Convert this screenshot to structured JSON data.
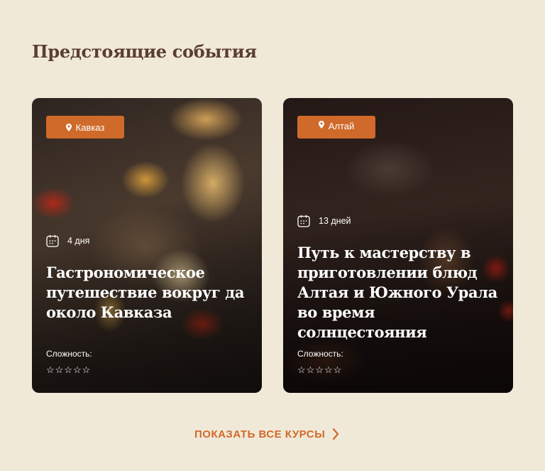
{
  "section": {
    "title": "Предстоящие события"
  },
  "events": [
    {
      "location": "Кавказ",
      "duration": "4 дня",
      "title": "Гастрономическое путешествие вокруг да около Кавказа",
      "difficulty_label": "Сложность:",
      "rating": 0,
      "rating_max": 5,
      "rating_display": "☆☆☆☆☆"
    },
    {
      "location": "Алтай",
      "duration": "13 дней",
      "title": "Путь к мастерству в приготовлении блюд Алтая и Южного Урала во время солнцестояния",
      "difficulty_label": "Сложность:",
      "rating": 0,
      "rating_max": 5,
      "rating_display": "☆☆☆☆☆"
    }
  ],
  "show_all": {
    "label": "ПОКАЗАТЬ ВСЕ КУРСЫ"
  },
  "colors": {
    "background": "#f1e9d8",
    "accent": "#cf6a2a",
    "heading": "#5a3d33"
  },
  "icons": {
    "location": "map-pin-icon",
    "duration": "calendar-icon",
    "link": "chevron-right-icon"
  }
}
